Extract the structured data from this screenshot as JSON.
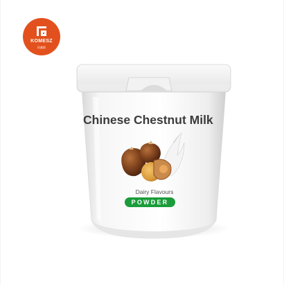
{
  "logo": {
    "brand": "KOMESZ",
    "sub": "科美斯",
    "color": "#e2511d"
  },
  "product": {
    "title": "Chinese Chestnut Milk",
    "subtitle": "Dairy Flavours",
    "badge": "POWDER",
    "badge_color": "#1a9c3a"
  }
}
